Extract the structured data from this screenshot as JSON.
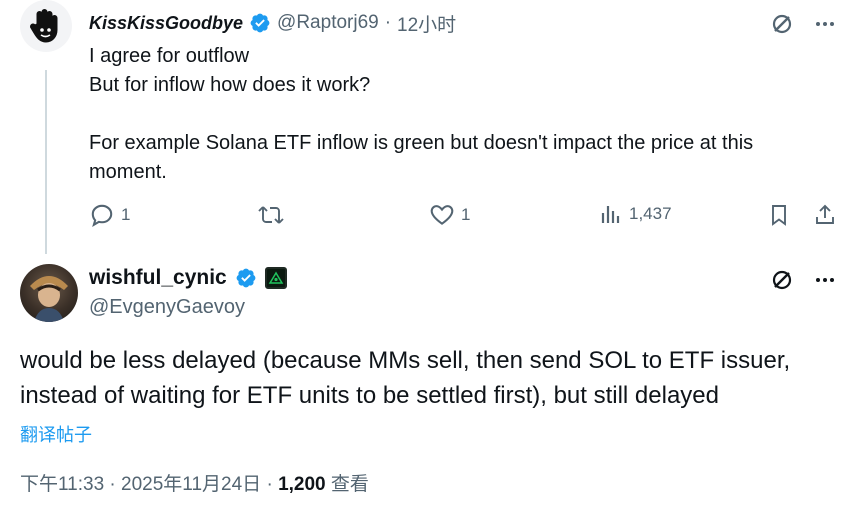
{
  "reply": {
    "name": "KissKissGoodbye",
    "handle": "@Raptorj69",
    "separator": "·",
    "time": "12小时",
    "lines": [
      "I agree for outflow",
      "But for inflow how does it work?",
      "",
      "For example Solana ETF inflow is green but doesn't impact the price at this",
      "moment."
    ],
    "replies": "1",
    "likes": "1",
    "views": "1,437",
    "icons": [
      "grok-icon",
      "more-icon",
      "reply-icon",
      "retweet-icon",
      "like-icon",
      "views-icon",
      "bookmark-icon",
      "share-icon"
    ]
  },
  "main": {
    "name": "wishful_cynic",
    "handle": "@EvgenyGaevoy",
    "text_line1": "would be less delayed (because MMs sell, then send SOL to ETF issuer,",
    "text_line2": "instead of waiting for ETF units to be settled first), but still delayed",
    "translate": "翻译帖子",
    "time": "下午11:33",
    "dot": "·",
    "date": "2025年11月24日",
    "views_count": "1,200",
    "views_label": "查看"
  },
  "colors": {
    "accent": "#1d9bf0",
    "muted": "#536471",
    "text": "#0f1419"
  }
}
